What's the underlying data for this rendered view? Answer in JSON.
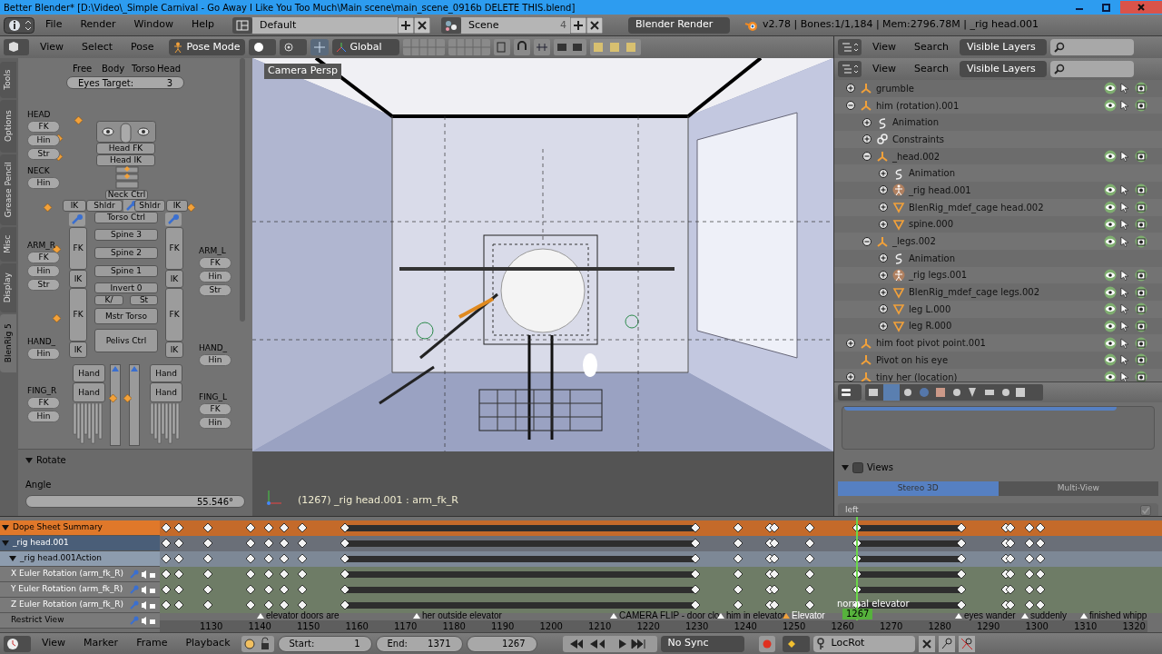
{
  "window": {
    "title": "Better Blender* [D:\\Video\\_Simple Carnival - Go Away I Like You Too Much\\Main scene\\main_scene_0916b DELETE THIS.blend]"
  },
  "info_header": {
    "menus": [
      "File",
      "Render",
      "Window",
      "Help"
    ],
    "screen_layout": "Default",
    "scene": "Scene",
    "scene_users": "4",
    "render_engine": "Blender Render",
    "stats": "v2.78 | Bones:1/1,184 | Mem:2796.78M | _rig head.001"
  },
  "view3d_header": {
    "menus": [
      "View",
      "Select",
      "Pose"
    ],
    "mode": "Pose Mode",
    "orientation": "Global"
  },
  "tool_tabs": [
    {
      "label": "Tools",
      "selected": false
    },
    {
      "label": "Options",
      "selected": false
    },
    {
      "label": "Grease Pencil",
      "selected": false
    },
    {
      "label": "Misc",
      "selected": false
    },
    {
      "label": "Display",
      "selected": false
    },
    {
      "label": "BlenRig 5",
      "selected": true
    }
  ],
  "rig_picker": {
    "tabs": [
      "Free",
      "Body",
      "Torso",
      "Head"
    ],
    "eyes_target": {
      "label": "Eyes Target:",
      "value": "3"
    },
    "side_groups": [
      {
        "heading": "HEAD",
        "buttons": [
          "FK",
          "Hin",
          "Str"
        ]
      },
      {
        "heading": "NECK",
        "buttons": [
          "Hin"
        ]
      },
      {
        "heading": "ARM_R",
        "buttons": [
          "FK",
          "Hin",
          "Str"
        ]
      },
      {
        "heading": "HAND_",
        "buttons": [
          "Hin"
        ]
      },
      {
        "heading": "FING_R",
        "buttons": [
          "FK",
          "Hin"
        ]
      },
      {
        "heading": "ARM_L",
        "buttons": [
          "FK",
          "Hin",
          "Str"
        ]
      },
      {
        "heading": "HAND_",
        "buttons": [
          "Hin"
        ]
      },
      {
        "heading": "FING_L",
        "buttons": [
          "FK",
          "Hin"
        ]
      }
    ],
    "body_buttons": [
      "Head FK",
      "Head IK",
      "Neck Ctrl",
      "IK",
      "Shldr",
      "Shldr",
      "IK",
      "Torso Ctrl",
      "Spine 3",
      "Spine 2",
      "Spine 1",
      "Invert 0",
      "K/",
      "St",
      "Mstr Torso",
      "Pelivs Ctrl",
      "FK",
      "IK",
      "FK",
      "IK",
      "FK",
      "IK",
      "FK",
      "IK",
      "Hand",
      "Hand",
      "Hand",
      "Hand"
    ]
  },
  "operator_panel": {
    "title": "Rotate",
    "expanded": true,
    "field_label": "Angle",
    "field_value": "55.546°"
  },
  "viewport": {
    "view_name": "Camera Persp",
    "status": "(1267) _rig head.001 : arm_fk_R"
  },
  "outliner_headers": [
    {
      "menus": [
        "View",
        "Search"
      ],
      "filter": "Visible Layers"
    },
    {
      "menus": [
        "View",
        "Search"
      ],
      "filter": "Visible Layers"
    }
  ],
  "outliner": {
    "items": [
      {
        "name": "grumble",
        "kind": "armature",
        "expanded": false
      },
      {
        "name": "him (rotation).001",
        "kind": "armature",
        "expanded": true,
        "children": [
          {
            "name": "Animation",
            "kind": "animation",
            "expanded": false
          },
          {
            "name": "Constraints",
            "kind": "constraints",
            "expanded": false
          },
          {
            "name": "_head.002",
            "kind": "armature",
            "expanded": true,
            "children": [
              {
                "name": "Animation",
                "kind": "animation",
                "expanded": false
              },
              {
                "name": "_rig head.001",
                "kind": "pose",
                "expanded": false
              },
              {
                "name": "BlenRig_mdef_cage head.002",
                "kind": "mesh",
                "expanded": false
              },
              {
                "name": "spine.000",
                "kind": "mesh",
                "expanded": false
              }
            ]
          },
          {
            "name": "_legs.002",
            "kind": "armature",
            "expanded": true,
            "children": [
              {
                "name": "Animation",
                "kind": "animation",
                "expanded": false
              },
              {
                "name": "_rig legs.001",
                "kind": "pose",
                "expanded": false
              },
              {
                "name": "BlenRig_mdef_cage legs.002",
                "kind": "mesh",
                "expanded": false
              },
              {
                "name": "leg L.000",
                "kind": "mesh",
                "expanded": false
              },
              {
                "name": "leg R.000",
                "kind": "mesh",
                "expanded": false
              }
            ]
          }
        ]
      },
      {
        "name": "him foot pivot point.001",
        "kind": "armature",
        "expanded": false
      },
      {
        "name": "Pivot on his eye",
        "kind": "armature"
      },
      {
        "name": "tiny her (location)",
        "kind": "armature",
        "expanded": false
      }
    ]
  },
  "properties": {
    "views": {
      "title": "Views",
      "expanded": true,
      "checked": false,
      "tabs": [
        {
          "label": "Stereo 3D",
          "selected": true
        },
        {
          "label": "Multi-View",
          "selected": false
        }
      ],
      "view_item": "left"
    }
  },
  "dope_sheet": {
    "channels": [
      {
        "name": "Dope Sheet Summary",
        "kind": "summary",
        "expanded": true
      },
      {
        "name": "_rig head.001",
        "kind": "object",
        "expanded": true
      },
      {
        "name": "_rig head.001Action",
        "kind": "action",
        "expanded": true
      },
      {
        "name": "X Euler Rotation (arm_fk_R)",
        "kind": "fcurve"
      },
      {
        "name": "Y Euler Rotation (arm_fk_R)",
        "kind": "fcurve"
      },
      {
        "name": "Z Euler Rotation (arm_fk_R)",
        "kind": "fcurve"
      },
      {
        "name": "Restrict View",
        "kind": "property"
      }
    ],
    "markers": [
      {
        "label": "elevator doors are",
        "selected": false
      },
      {
        "label": "her outside elevator",
        "selected": false
      },
      {
        "label": "CAMERA FLIP - door clo",
        "selected": false
      },
      {
        "label": "him in elevator",
        "selected": false
      },
      {
        "label": "Elevator",
        "selected": true
      },
      {
        "label": "eyes wander",
        "selected": false
      },
      {
        "label": "suddenly",
        "selected": false
      },
      {
        "label": "finished whipp",
        "selected": false
      }
    ],
    "frame_ticks": [
      "1130",
      "1140",
      "1150",
      "1160",
      "1170",
      "1180",
      "1190",
      "1200",
      "1210",
      "1220",
      "1230",
      "1240",
      "1250",
      "1260",
      "1270",
      "1280",
      "1290",
      "1300",
      "1310",
      "1320"
    ],
    "current_frame": "1267",
    "current_marker": "normal elevator"
  },
  "timeline": {
    "menus": [
      "View",
      "Marker",
      "Frame",
      "Playback"
    ],
    "start_label": "Start:",
    "start": "1",
    "end_label": "End:",
    "end": "1371",
    "current": "1267",
    "sync": "No Sync",
    "keying_set": "LocRot"
  }
}
